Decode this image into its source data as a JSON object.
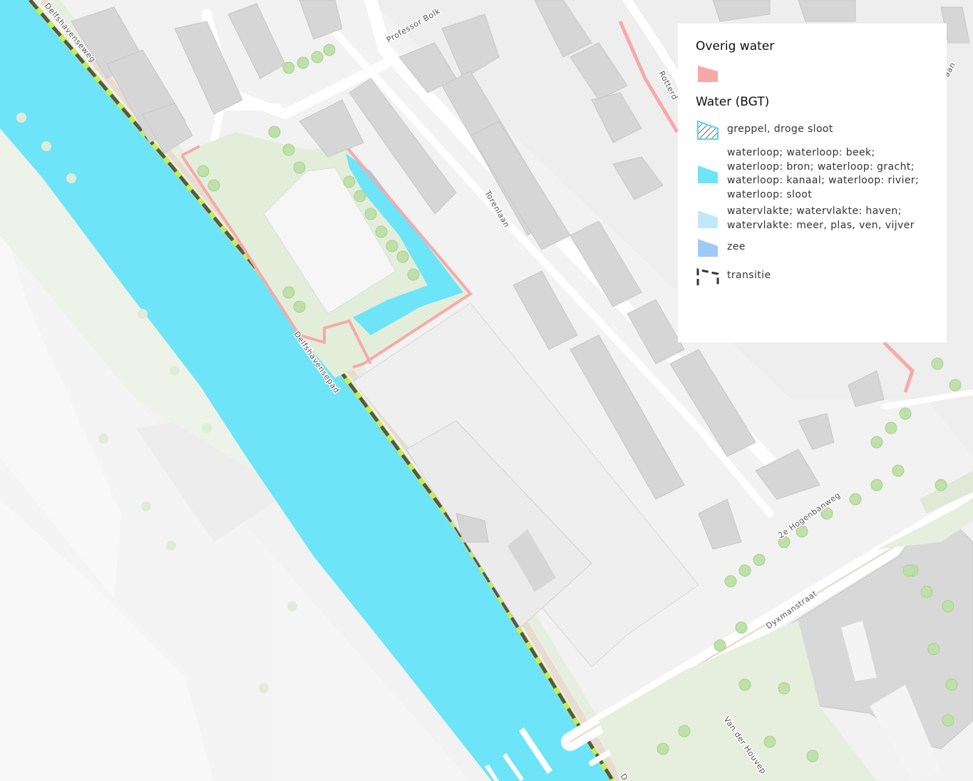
{
  "map": {
    "streets": {
      "delfshavenseweg": "Delfshavenseweg",
      "professor_bolk": "Professor Bolk",
      "torenlaan": "Torenlaan",
      "delfshavensepad": "Delfshavensepad",
      "rotterdam_partial": "Rotterd",
      "laan_partial": "laan",
      "hogenbanweg": "2e Hogenbanweg",
      "dyxmanstraat": "Dyxmanstraat",
      "van_der_houven": "Van der Houvep",
      "d_partial": "D"
    },
    "colors": {
      "water": "#6de4f8",
      "overig_water": "#f7a9a9",
      "vegetation": "#e3eeda",
      "building": "#d6d6d6",
      "road": "#ffffff",
      "transitie_line": "#333333",
      "bank_green": "#c6ec54"
    }
  },
  "legend": {
    "groups": [
      {
        "title": "Overig water",
        "items": [
          {
            "label": "",
            "swatch": "overig-water",
            "icon": "pink-polygon-swatch"
          }
        ]
      },
      {
        "title": "Water (BGT)",
        "items": [
          {
            "label": "greppel, droge sloot",
            "swatch": "hatched",
            "icon": "hatched-polygon-swatch"
          },
          {
            "label": "waterloop; waterloop: beek; waterloop: bron; waterloop: gracht; waterloop: kanaal; waterloop: rivier; waterloop: sloot",
            "swatch": "waterloop",
            "icon": "cyan-polygon-swatch"
          },
          {
            "label": "watervlakte; watervlakte: haven; watervlakte: meer, plas, ven, vijver",
            "swatch": "watervlakte",
            "icon": "light-blue-polygon-swatch"
          },
          {
            "label": "zee",
            "swatch": "zee",
            "icon": "blue-polygon-swatch"
          },
          {
            "label": "transitie",
            "swatch": "transitie",
            "icon": "transitie-line-swatch"
          }
        ]
      }
    ]
  }
}
